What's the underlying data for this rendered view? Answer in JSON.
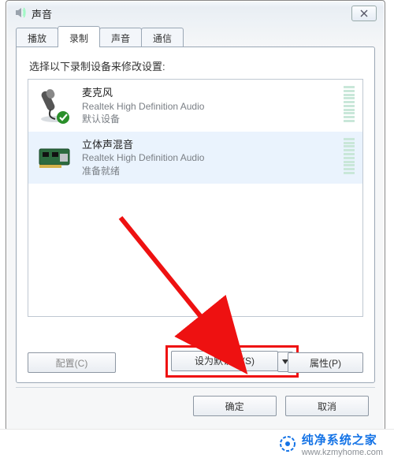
{
  "window": {
    "title": "声音",
    "close_glyph": "✕"
  },
  "tabs": {
    "playback": "播放",
    "record": "录制",
    "sounds": "声音",
    "comm": "通信"
  },
  "prompt": "选择以下录制设备来修改设置:",
  "devices": [
    {
      "name": "麦克风",
      "driver": "Realtek High Definition Audio",
      "status": "默认设备"
    },
    {
      "name": "立体声混音",
      "driver": "Realtek High Definition Audio",
      "status": "准备就绪"
    }
  ],
  "buttons": {
    "configure": "配置(C)",
    "set_default": "设为默认值(S)",
    "properties": "属性(P)",
    "ok": "确定",
    "cancel": "取消"
  },
  "watermark": {
    "brand": "纯净系统之家",
    "url": "www.kzmyhome.com"
  }
}
